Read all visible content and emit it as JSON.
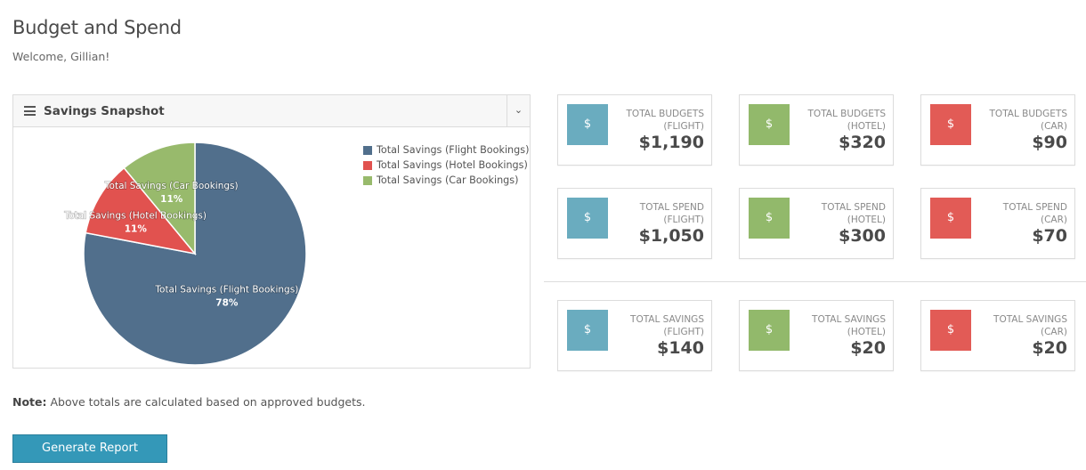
{
  "page": {
    "title": "Budget and Spend",
    "welcome": "Welcome, Gillian!"
  },
  "snapshot": {
    "title": "Savings Snapshot",
    "menu_icon": "hamburger-menu-icon",
    "toggle_icon": "chevron-down-icon"
  },
  "colors": {
    "flight": "#6aacbf",
    "hotel": "#92b96b",
    "car": "#e25b56",
    "pie_flight": "#516f8c",
    "pie_hotel": "#e1524f",
    "pie_car": "#98ba6c",
    "button": "#3498b8"
  },
  "chart_data": {
    "type": "pie",
    "series": [
      {
        "name": "Total Savings (Flight Bookings)",
        "value": 78,
        "label": "78%",
        "color": "#516f8c"
      },
      {
        "name": "Total Savings (Hotel Bookings)",
        "value": 11,
        "label": "11%",
        "color": "#e1524f"
      },
      {
        "name": "Total Savings (Car Bookings)",
        "value": 11,
        "label": "11%",
        "color": "#98ba6c"
      }
    ],
    "legend_position": "top-right"
  },
  "cards": {
    "budgets": [
      {
        "label1": "TOTAL BUDGETS",
        "label2": "(FLIGHT)",
        "value": "$1,190",
        "icon": "$"
      },
      {
        "label1": "TOTAL BUDGETS",
        "label2": "(HOTEL)",
        "value": "$320",
        "icon": "$"
      },
      {
        "label1": "TOTAL BUDGETS",
        "label2": "(CAR)",
        "value": "$90",
        "icon": "$"
      }
    ],
    "spend": [
      {
        "label1": "TOTAL SPEND",
        "label2": "(FLIGHT)",
        "value": "$1,050",
        "icon": "$"
      },
      {
        "label1": "TOTAL SPEND",
        "label2": "(HOTEL)",
        "value": "$300",
        "icon": "$"
      },
      {
        "label1": "TOTAL SPEND",
        "label2": "(CAR)",
        "value": "$70",
        "icon": "$"
      }
    ],
    "savings": [
      {
        "label1": "TOTAL SAVINGS",
        "label2": "(FLIGHT)",
        "value": "$140",
        "icon": "$"
      },
      {
        "label1": "TOTAL SAVINGS",
        "label2": "(HOTEL)",
        "value": "$20",
        "icon": "$"
      },
      {
        "label1": "TOTAL SAVINGS",
        "label2": "(CAR)",
        "value": "$20",
        "icon": "$"
      }
    ]
  },
  "note": {
    "bold": "Note:",
    "text": " Above totals are calculated based on approved budgets."
  },
  "actions": {
    "generate_report": "Generate Report"
  }
}
